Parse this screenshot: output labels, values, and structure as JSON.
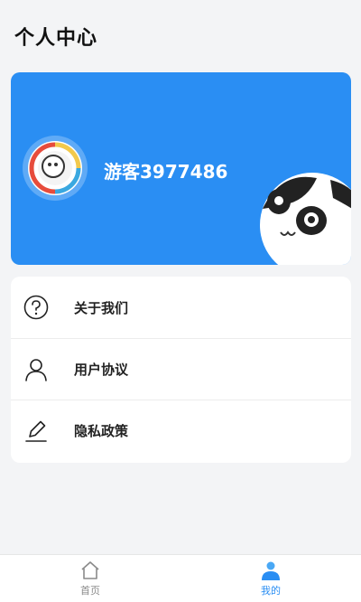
{
  "header": {
    "title": "个人中心"
  },
  "profile": {
    "username": "游客3977486"
  },
  "menu": {
    "items": [
      {
        "label": "关于我们",
        "icon": "question-circle-icon"
      },
      {
        "label": "用户协议",
        "icon": "user-icon"
      },
      {
        "label": "隐私政策",
        "icon": "edit-pencil-icon"
      }
    ]
  },
  "tabbar": {
    "tabs": [
      {
        "label": "首页",
        "icon": "home-icon",
        "active": false
      },
      {
        "label": "我的",
        "icon": "person-filled-icon",
        "active": true
      }
    ]
  },
  "colors": {
    "accent": "#2a8ef3",
    "background": "#f3f4f6",
    "card": "#ffffff"
  }
}
